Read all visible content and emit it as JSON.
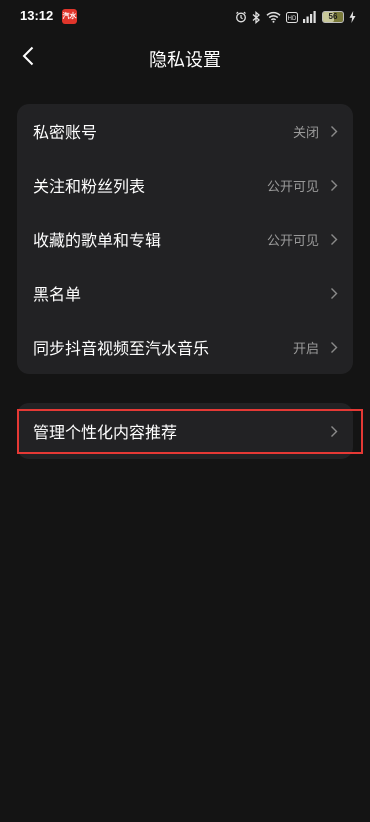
{
  "status_bar": {
    "time": "13:12",
    "app_badge": "汽水",
    "battery_level": 56,
    "battery_text": "56",
    "icons": [
      "alarm-icon",
      "bluetooth-icon",
      "wifi-icon",
      "hd-icon",
      "signal-icon",
      "battery-icon",
      "charging-icon"
    ]
  },
  "header": {
    "title": "隐私设置",
    "back_icon": "chevron-left-icon"
  },
  "settings": [
    {
      "label": "私密账号",
      "value": "关闭"
    },
    {
      "label": "关注和粉丝列表",
      "value": "公开可见"
    },
    {
      "label": "收藏的歌单和专辑",
      "value": "公开可见"
    },
    {
      "label": "黑名单",
      "value": ""
    },
    {
      "label": "同步抖音视频至汽水音乐",
      "value": "开启"
    }
  ],
  "personalization": {
    "label": "管理个性化内容推荐"
  },
  "colors": {
    "background": "#141414",
    "card": "#222224",
    "secondary_text": "#9a9a9a",
    "highlight": "#e53935"
  }
}
